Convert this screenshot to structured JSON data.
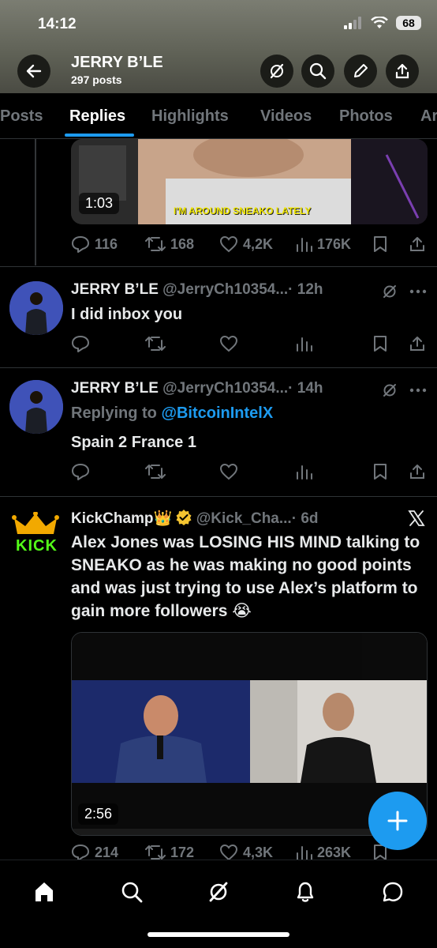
{
  "status_bar": {
    "time": "14:12",
    "battery": "68"
  },
  "header": {
    "name": "JERRY B’LE",
    "post_count": "297 posts"
  },
  "tabs": [
    "Posts",
    "Replies",
    "Highlights",
    "Videos",
    "Photos",
    "Ar"
  ],
  "tweet1": {
    "video_duration": "1:03",
    "caption": "I'M AROUND SNEAKO LATELY",
    "replies": "116",
    "reposts": "168",
    "likes": "4,2K",
    "views": "176K"
  },
  "tweet2": {
    "name": "JERRY B’LE",
    "handle": "@JerryCh10354...",
    "time": "· 12h",
    "text": "I did inbox you"
  },
  "tweet3": {
    "name": "JERRY B’LE",
    "handle": "@JerryCh10354...",
    "time": "· 14h",
    "replying_prefix": "Replying to ",
    "replying_to": "@BitcoinIntelX",
    "text": "Spain 2 France 1"
  },
  "tweet4": {
    "avatar_logo": "KICK",
    "name": "KickChamp👑",
    "handle": "@Kick_Cha...",
    "time": "· 6d",
    "text": "Alex Jones was LOSING HIS MIND talking to SNEAKO as he was making no good points and was just trying to use Alex’s platform to gain more followers 😭",
    "video_duration": "2:56",
    "replies": "214",
    "reposts": "172",
    "likes": "4,3K",
    "views": "263K"
  },
  "colors": {
    "accent": "#1d9bf0",
    "muted": "#71767b",
    "verified": "#f4c430"
  }
}
